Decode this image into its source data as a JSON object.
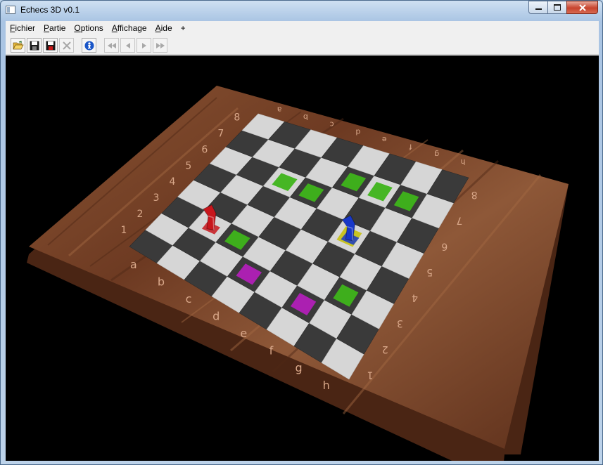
{
  "window": {
    "title": "Echecs 3D v0.1"
  },
  "menu": {
    "items": [
      {
        "key": "F",
        "rest": "ichier"
      },
      {
        "key": "P",
        "rest": "artie"
      },
      {
        "key": "O",
        "rest": "ptions"
      },
      {
        "key": "A",
        "rest": "ffichage"
      },
      {
        "key": "A",
        "rest": "ide"
      },
      {
        "key": "",
        "rest": "+"
      }
    ]
  },
  "board": {
    "ranks": [
      "1",
      "2",
      "3",
      "4",
      "5",
      "6",
      "7",
      "8"
    ],
    "files": [
      "a",
      "b",
      "c",
      "d",
      "e",
      "f",
      "g",
      "h"
    ],
    "colors": {
      "light": "#d6d6d6",
      "dark": "#3a3a3a",
      "move": "#3fb51b",
      "capture": "#b21fb8",
      "selected": "#c8c21a",
      "wood": "#7a4428",
      "red_piece": "#c8161c",
      "blue_piece": "#1838c8"
    }
  }
}
